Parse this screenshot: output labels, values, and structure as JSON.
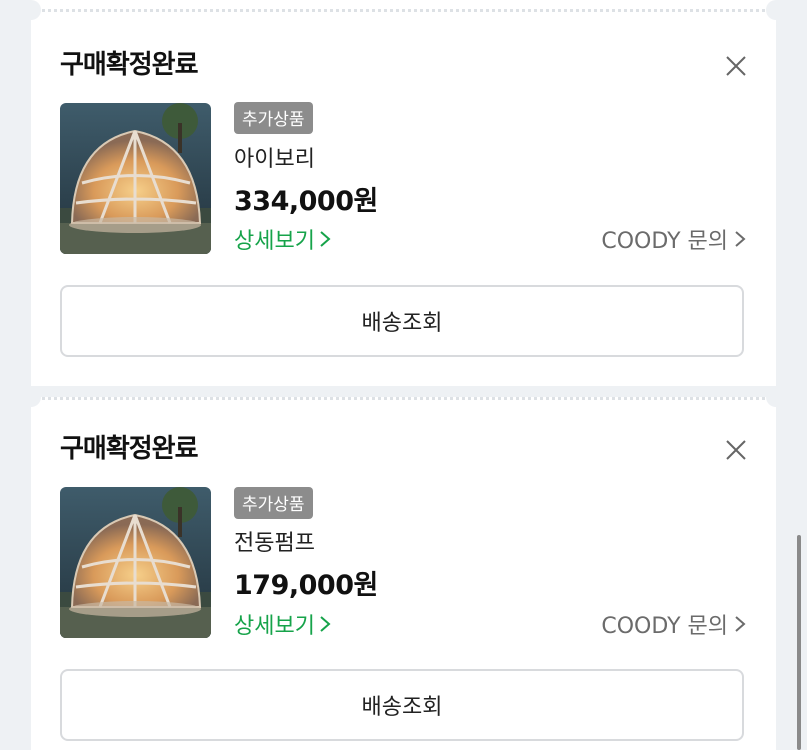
{
  "orders": [
    {
      "status": "구매확정완료",
      "badge": "추가상품",
      "option": "아이보리",
      "price": "334,000원",
      "detail_label": "상세보기",
      "inquiry_label": "COODY 문의",
      "shipping_button": "배송조회"
    },
    {
      "status": "구매확정완료",
      "badge": "추가상품",
      "option": "전동펌프",
      "price": "179,000원",
      "detail_label": "상세보기",
      "inquiry_label": "COODY 문의",
      "shipping_button": "배송조회"
    }
  ],
  "icons": {
    "close": "close-icon",
    "chevron": "chevron-right-icon",
    "thumbnail": "dome-tent-image"
  },
  "colors": {
    "accent_green": "#16a34a",
    "badge_gray": "#8c8c8c",
    "background": "#eef1f4"
  }
}
